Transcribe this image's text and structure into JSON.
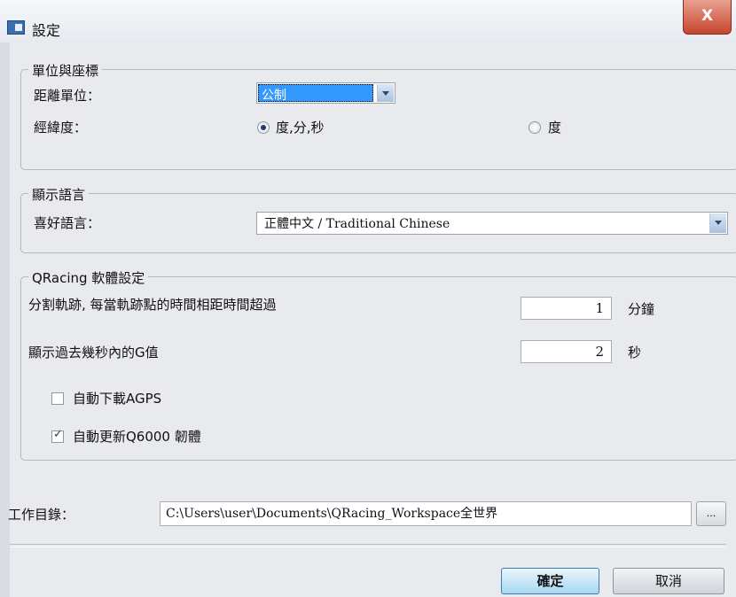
{
  "window": {
    "title": "設定",
    "close_label": "X"
  },
  "units_group": {
    "legend": "單位與座標",
    "distance_label": "距離單位：",
    "distance_value": "公制",
    "latlon_label": "經緯度：",
    "radio_dms_label": "度,分,秒",
    "radio_deg_label": "度",
    "selected": "度,分,秒"
  },
  "language_group": {
    "legend": "顯示語言",
    "preferred_label": "喜好語言：",
    "preferred_value": "正體中文 / Traditional Chinese"
  },
  "qracing_group": {
    "legend": "QRacing 軟體設定",
    "split_label": "分割軌跡, 每當軌跡點的時間相距時間超過",
    "split_value": "1",
    "split_unit": "分鐘",
    "gvalue_label": "顯示過去幾秒內的G值",
    "gvalue_value": "2",
    "gvalue_unit": "秒",
    "agps_label": "自動下載AGPS",
    "agps_checked": false,
    "firmware_label": "自動更新Q6000 韌體",
    "firmware_checked": true
  },
  "workdir": {
    "label": "工作目錄：",
    "path": "C:\\Users\\user\\Documents\\QRacing_Workspace全世界",
    "browse_label": "..."
  },
  "buttons": {
    "ok": "確定",
    "cancel": "取消"
  },
  "colors": {
    "selection": "#3399ff",
    "close_button": "#c7452e",
    "dialog_bg": "#e8eaed"
  }
}
